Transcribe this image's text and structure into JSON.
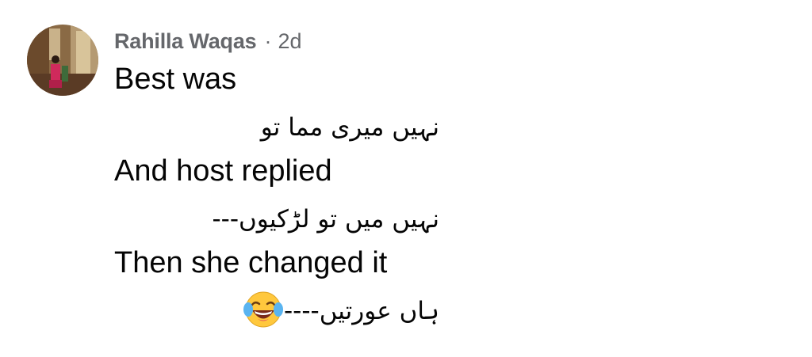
{
  "comment": {
    "author": "Rahilla Waqas",
    "separator": "·",
    "time": "2d",
    "lines": [
      "Best was",
      "نہیں میری مما تو",
      "And host replied",
      "نہیں میں تو لڑکیوں---",
      "Then she changed it",
      "ہاں عورتیں----"
    ],
    "emoji": "face-with-tears-of-joy"
  },
  "colors": {
    "meta_text": "#65676b",
    "body_text": "#050505",
    "emoji_face": "#ffc83d"
  }
}
